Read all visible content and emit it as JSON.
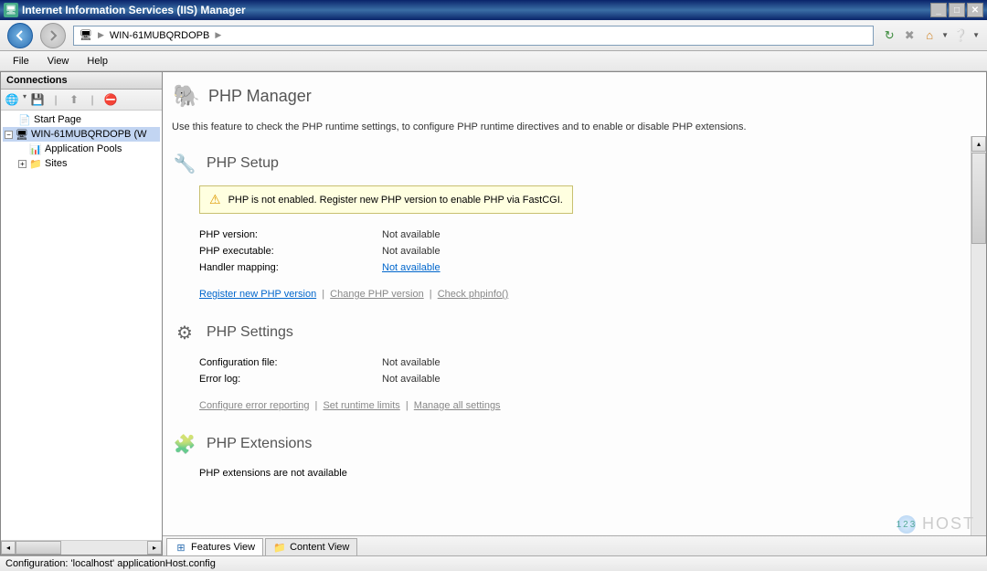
{
  "window": {
    "title": "Internet Information Services (IIS) Manager"
  },
  "breadcrumb": {
    "node": "WIN-61MUBQRDOPB"
  },
  "menu": {
    "file": "File",
    "view": "View",
    "help": "Help"
  },
  "connections": {
    "header": "Connections",
    "tree": {
      "start": "Start Page",
      "server": "WIN-61MUBQRDOPB (W",
      "apppools": "Application Pools",
      "sites": "Sites"
    }
  },
  "page": {
    "title": "PHP Manager",
    "intro": "Use this feature to check the PHP runtime settings, to configure PHP runtime directives and to enable or disable PHP extensions."
  },
  "setup": {
    "title": "PHP Setup",
    "warning": "PHP is not enabled. Register new PHP version to enable PHP via FastCGI.",
    "rows": {
      "version_label": "PHP version:",
      "version_value": "Not available",
      "exe_label": "PHP executable:",
      "exe_value": "Not available",
      "handler_label": "Handler mapping:",
      "handler_value": "Not available"
    },
    "links": {
      "register": "Register new PHP version",
      "change": "Change PHP version",
      "phpinfo": "Check phpinfo()"
    }
  },
  "settings": {
    "title": "PHP Settings",
    "rows": {
      "config_label": "Configuration file:",
      "config_value": "Not available",
      "errorlog_label": "Error log:",
      "errorlog_value": "Not available"
    },
    "links": {
      "error_reporting": "Configure error reporting",
      "runtime_limits": "Set runtime limits",
      "manage_all": "Manage all settings"
    }
  },
  "extensions": {
    "title": "PHP Extensions",
    "msg": "PHP extensions are not available"
  },
  "tabs": {
    "features": "Features View",
    "content": "Content View"
  },
  "status": "Configuration: 'localhost' applicationHost.config",
  "watermark": "HOST",
  "watermark_logo": "123"
}
